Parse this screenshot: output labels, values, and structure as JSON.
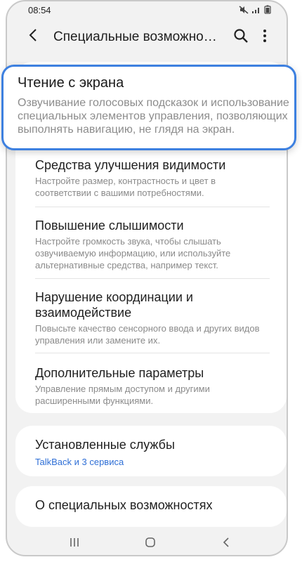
{
  "status": {
    "time": "08:54"
  },
  "appbar": {
    "title": "Специальные возможно…"
  },
  "highlight": {
    "title": "Чтение с экрана",
    "description": "Озвучивание голосовых подсказок и использование специальных элементов управления, позволяющих выполнять навигацию, не глядя на экран."
  },
  "items": [
    {
      "title": "Средства улучшения видимости",
      "description": "Настройте размер, контрастность и цвет в соответствии с вашими потребностями."
    },
    {
      "title": "Повышение слышимости",
      "description": "Настройте громкость звука, чтобы слышать озвучиваемую информацию, или используйте альтернативные средства, например текст."
    },
    {
      "title": "Нарушение координации и взаимодействие",
      "description": "Повысьте качество сенсорного ввода и других видов управления или замените их."
    },
    {
      "title": "Дополнительные параметры",
      "description": "Управление прямым доступом и другими расширенными функциями."
    }
  ],
  "installed": {
    "title": "Установленные службы",
    "subtitle": "TalkBack и 3 сервиса"
  },
  "about": {
    "title": "О специальных возможностях"
  },
  "colors": {
    "accent": "#3d80e0",
    "link": "#2f6fd6"
  }
}
